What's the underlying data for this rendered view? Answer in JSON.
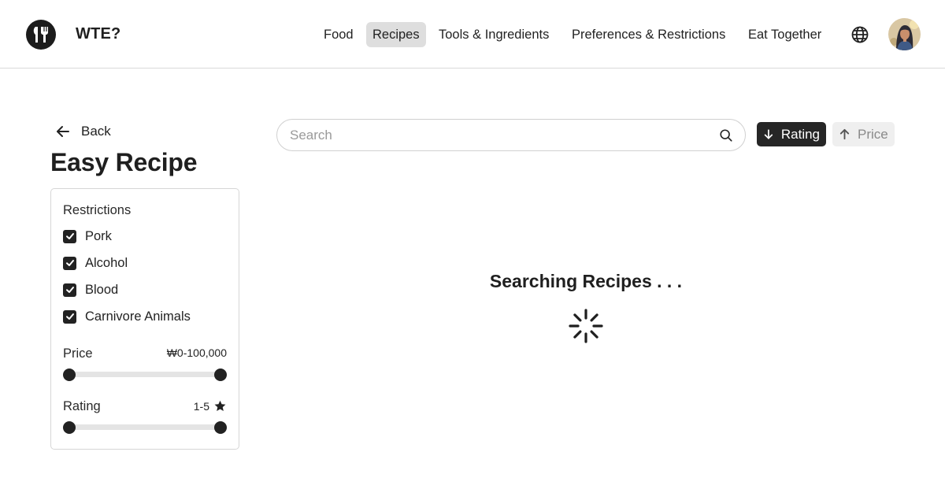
{
  "brand": {
    "name": "WTE?",
    "logo_icon": "fork-knife-icon"
  },
  "nav": {
    "items": [
      {
        "label": "Food",
        "active": false
      },
      {
        "label": "Recipes",
        "active": true
      },
      {
        "label": "Tools & Ingredients",
        "active": false
      },
      {
        "label": "Preferences & Restrictions",
        "active": false
      },
      {
        "label": "Eat Together",
        "active": false
      }
    ],
    "language_icon": "globe-icon",
    "avatar_icon": "user-avatar"
  },
  "sidebar": {
    "back_label": "Back",
    "title": "Easy Recipe",
    "restrictions_heading": "Restrictions",
    "restrictions": [
      {
        "label": "Pork",
        "checked": true
      },
      {
        "label": "Alcohol",
        "checked": true
      },
      {
        "label": "Blood",
        "checked": true
      },
      {
        "label": "Carnivore Animals",
        "checked": true
      }
    ],
    "price": {
      "label": "Price",
      "range_text": "₩0-100,000",
      "min_fraction": 0,
      "max_fraction": 1
    },
    "rating": {
      "label": "Rating",
      "range_text": "1-5",
      "min_fraction": 0,
      "max_fraction": 1,
      "icon": "star-icon"
    }
  },
  "search": {
    "placeholder": "Search",
    "value": ""
  },
  "sort": {
    "rating": {
      "label": "Rating",
      "direction": "down",
      "active": true
    },
    "price": {
      "label": "Price",
      "direction": "up",
      "active": false
    }
  },
  "status": {
    "loading_text": "Searching Recipes . . ."
  },
  "colors": {
    "dark": "#222222",
    "active_nav": "#dedede",
    "border": "#d6d6d6",
    "muted": "#8a8a8a"
  }
}
